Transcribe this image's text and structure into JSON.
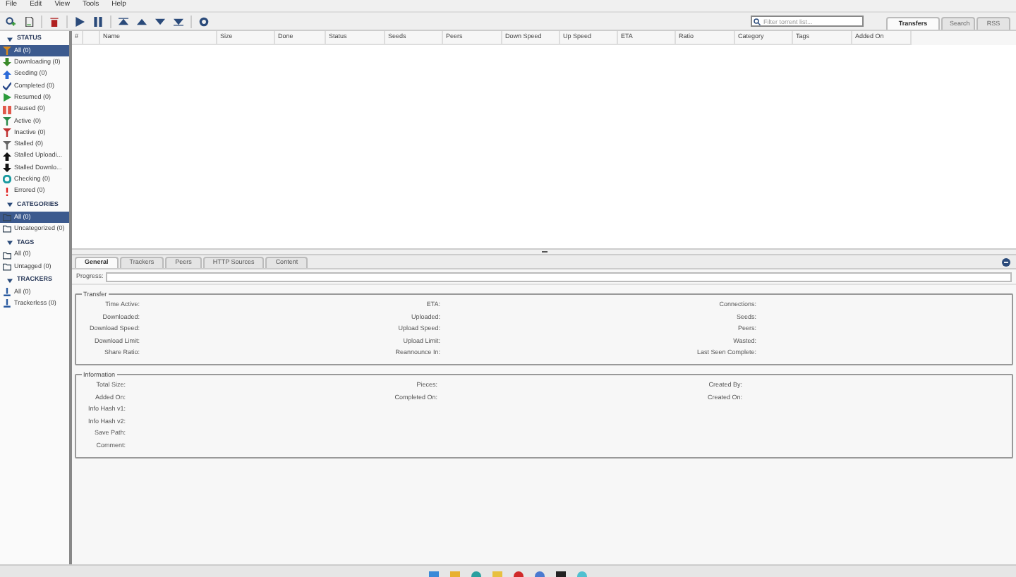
{
  "menu": [
    "File",
    "Edit",
    "View",
    "Tools",
    "Help"
  ],
  "search": {
    "placeholder": "Filter torrent list..."
  },
  "view_tabs": [
    {
      "label": "Transfers",
      "selected": true
    },
    {
      "label": "Search",
      "selected": false
    },
    {
      "label": "RSS",
      "selected": false
    }
  ],
  "sidebar": [
    {
      "title": "STATUS",
      "expanded": true,
      "items": [
        {
          "label": "All (0)",
          "selected": true
        },
        {
          "label": "Downloading (0)",
          "selected": false
        },
        {
          "label": "Seeding (0)",
          "selected": false
        },
        {
          "label": "Completed (0)",
          "selected": false
        },
        {
          "label": "Resumed (0)",
          "selected": false
        },
        {
          "label": "Paused (0)",
          "selected": false
        },
        {
          "label": "Active (0)",
          "selected": false
        },
        {
          "label": "Inactive (0)",
          "selected": false
        },
        {
          "label": "Stalled (0)",
          "selected": false
        },
        {
          "label": "Stalled Uploadi...",
          "selected": false
        },
        {
          "label": "Stalled Downlo...",
          "selected": false
        },
        {
          "label": "Checking (0)",
          "selected": false
        },
        {
          "label": "Errored (0)",
          "selected": false
        }
      ]
    },
    {
      "title": "CATEGORIES",
      "expanded": true,
      "items": [
        {
          "label": "All (0)",
          "selected": true
        },
        {
          "label": "Uncategorized (0)",
          "selected": false
        }
      ]
    },
    {
      "title": "TAGS",
      "expanded": true,
      "items": [
        {
          "label": "All (0)",
          "selected": false
        },
        {
          "label": "Untagged (0)",
          "selected": false
        }
      ]
    },
    {
      "title": "TRACKERS",
      "expanded": true,
      "items": [
        {
          "label": "All (0)",
          "selected": false
        },
        {
          "label": "Trackerless (0)",
          "selected": false
        }
      ]
    }
  ],
  "table": {
    "columns": [
      "#",
      "",
      "Name",
      "Size",
      "Done",
      "Status",
      "Seeds",
      "Peers",
      "Down Speed",
      "Up Speed",
      "ETA",
      "Ratio",
      "Category",
      "Tags",
      "Added On"
    ]
  },
  "details": {
    "tabs": [
      {
        "label": "General",
        "selected": true
      },
      {
        "label": "Trackers",
        "selected": false
      },
      {
        "label": "Peers",
        "selected": false
      },
      {
        "label": "HTTP Sources",
        "selected": false
      },
      {
        "label": "Content",
        "selected": false
      }
    ],
    "progress_label": "Progress:",
    "progress": {
      "level": 0
    },
    "groups": [
      {
        "title": "Transfer",
        "columns": [
          [
            "Time Active:",
            "Downloaded:",
            "Download Speed:",
            "Download Limit:",
            "Share Ratio:"
          ],
          [
            "ETA:",
            "Uploaded:",
            "Upload Speed:",
            "Upload Limit:",
            "Reannounce In:"
          ],
          [
            "Connections:",
            "Seeds:",
            "Peers:",
            "Wasted:",
            "Last Seen Complete:"
          ]
        ]
      },
      {
        "title": "Information",
        "columns": [
          [
            "Total Size:",
            "Added On:",
            "Info Hash v1:",
            "Info Hash v2:",
            "Save Path:",
            "Comment:"
          ],
          [
            "Pieces:",
            "Completed On:"
          ],
          [
            "Created By:",
            "Created On:"
          ]
        ]
      }
    ]
  }
}
